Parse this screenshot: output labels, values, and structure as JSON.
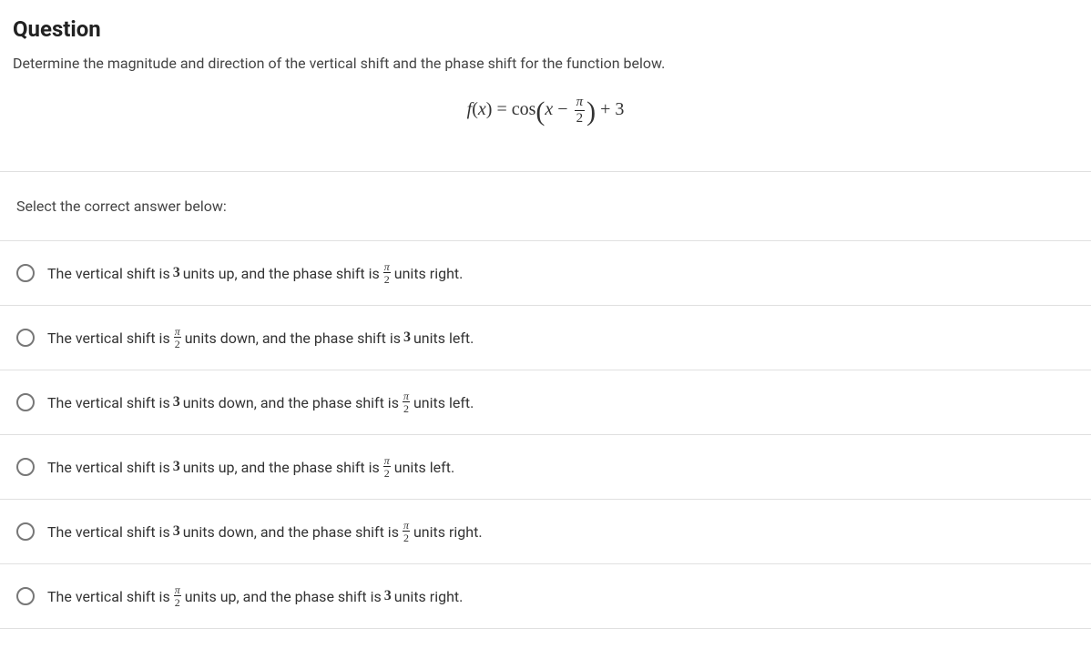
{
  "question": {
    "heading": "Question",
    "prompt": "Determine the magnitude and direction of the vertical shift and the phase shift for the function below.",
    "formula": {
      "lhs_f": "f",
      "lhs_open": "(",
      "lhs_x": "x",
      "lhs_close": ")",
      "eq": " = ",
      "cos": "cos",
      "lparen": "(",
      "inner_x": "x",
      "minus": " − ",
      "frac_num": "π",
      "frac_den": "2",
      "rparen": ")",
      "plus3": " + 3"
    },
    "instruction": "Select the correct answer below:"
  },
  "options": [
    {
      "p1": "The vertical shift is ",
      "num1": "3",
      "p2": " units up, and the phase shift is ",
      "fracNum": "π",
      "fracDen": "2",
      "p3": " units right.",
      "fracFirst": false
    },
    {
      "p1": "The vertical shift is ",
      "fracNum": "π",
      "fracDen": "2",
      "p2": " units down, and the phase shift is ",
      "num1": "3",
      "p3": " units left.",
      "fracFirst": true
    },
    {
      "p1": "The vertical shift is ",
      "num1": "3",
      "p2": " units down, and the phase shift is ",
      "fracNum": "π",
      "fracDen": "2",
      "p3": " units left.",
      "fracFirst": false
    },
    {
      "p1": "The vertical shift is ",
      "num1": "3",
      "p2": " units up, and the phase shift is ",
      "fracNum": "π",
      "fracDen": "2",
      "p3": " units left.",
      "fracFirst": false
    },
    {
      "p1": "The vertical shift is ",
      "num1": "3",
      "p2": " units down, and the phase shift is ",
      "fracNum": "π",
      "fracDen": "2",
      "p3": " units right.",
      "fracFirst": false
    },
    {
      "p1": "The vertical shift is ",
      "fracNum": "π",
      "fracDen": "2",
      "p2": " units up, and the phase shift is ",
      "num1": "3",
      "p3": " units right.",
      "fracFirst": true
    }
  ]
}
